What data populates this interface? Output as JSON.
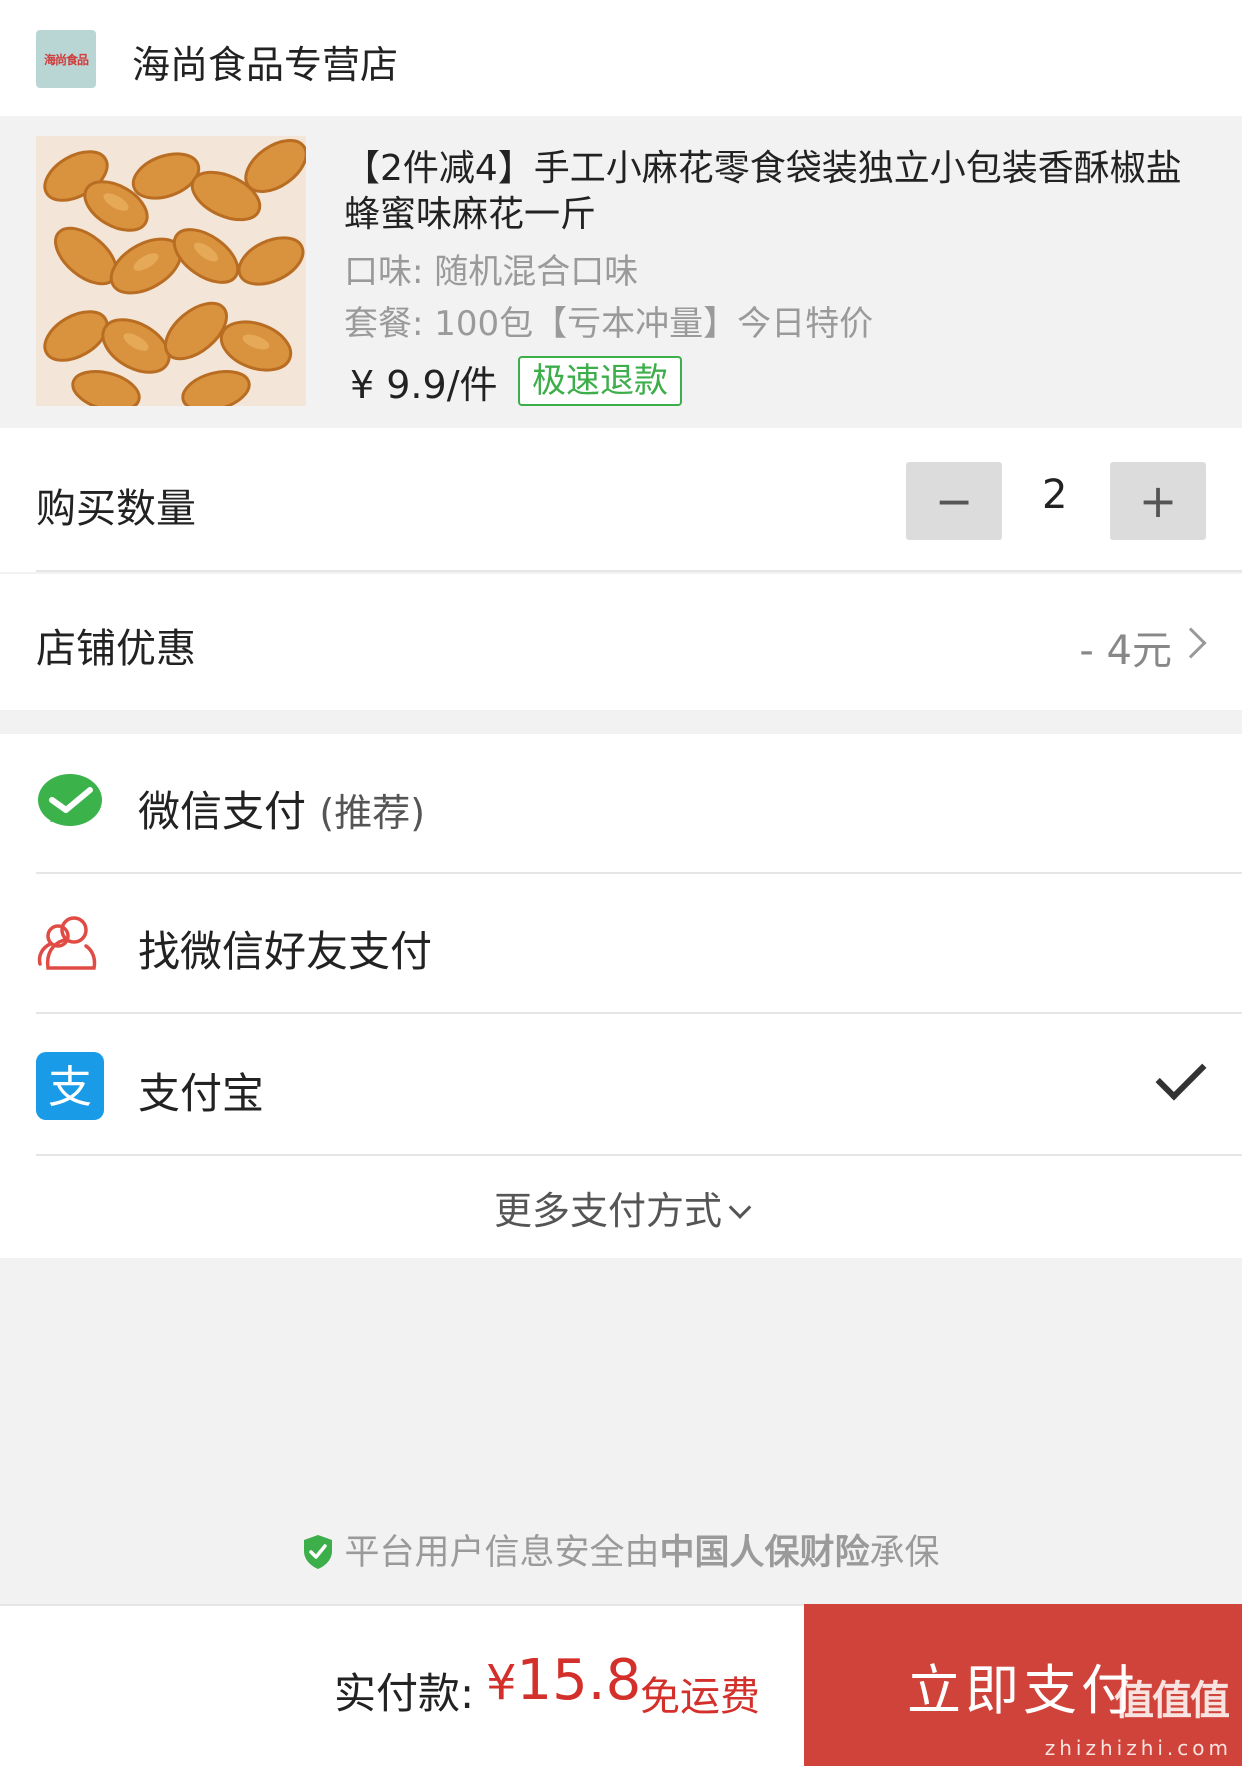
{
  "shop": {
    "logo_text": "海尚食品",
    "name": "海尚食品专营店"
  },
  "product": {
    "title": "【2件减4】手工小麻花零食袋装独立小包装香酥椒盐蜂蜜味麻花一斤",
    "flavor": "口味: 随机混合口味",
    "package": "套餐: 100包【亏本冲量】今日特价",
    "price": "¥ 9.9/件",
    "badge": "极速退款",
    "image_icon": "fried-dough-twist-image"
  },
  "quantity": {
    "label": "购买数量",
    "minus": "−",
    "plus": "+",
    "value": "2"
  },
  "discount": {
    "label": "店铺优惠",
    "value": "- 4元"
  },
  "payment": {
    "wechat": {
      "label": "微信支付",
      "note": "(推荐)",
      "icon": "wechat-pay-icon"
    },
    "friend": {
      "label": "找微信好友支付",
      "icon": "friend-pay-icon"
    },
    "alipay": {
      "label": "支付宝",
      "icon": "alipay-icon",
      "selected": true
    },
    "more": "更多支付方式"
  },
  "security": {
    "prefix": "平台用户信息安全由",
    "insurer": "中国人保财险",
    "suffix": "承保"
  },
  "checkout": {
    "total_label": "实付款:",
    "currency": "¥",
    "total": "15.8",
    "shipping": "免运费",
    "pay_button": "立即支付"
  },
  "watermark": {
    "text": "值值值",
    "url": "zhizhizhi.com"
  },
  "colors": {
    "accent_red": "#d0433a",
    "price_red": "#d4302b",
    "badge_green": "#3cae4a",
    "wechat_green": "#3cb34a",
    "alipay_blue": "#1a9be8"
  }
}
